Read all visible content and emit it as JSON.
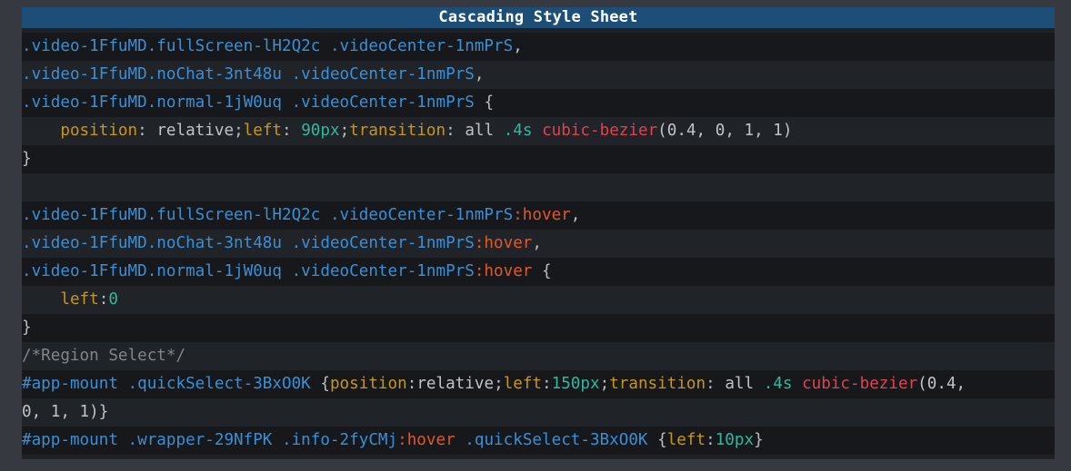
{
  "title": "Cascading Style Sheet",
  "lines": [
    [
      [
        ".video-1FfuMD.fullScreen-lH2Q2c .videoCenter-1nmPrS",
        "sel"
      ],
      [
        ",",
        "pun"
      ]
    ],
    [
      [
        ".video-1FfuMD.noChat-3nt48u .videoCenter-1nmPrS",
        "sel"
      ],
      [
        ",",
        "pun"
      ]
    ],
    [
      [
        ".video-1FfuMD.normal-1jW0uq .videoCenter-1nmPrS ",
        "sel"
      ],
      [
        "{",
        "pun"
      ]
    ],
    [
      [
        "    ",
        "val"
      ],
      [
        "position",
        "prop"
      ],
      [
        ": ",
        "pun"
      ],
      [
        "relative",
        "val"
      ],
      [
        ";",
        "pun"
      ],
      [
        "left",
        "prop"
      ],
      [
        ": ",
        "pun"
      ],
      [
        "90px",
        "num"
      ],
      [
        ";",
        "pun"
      ],
      [
        "transition",
        "prop"
      ],
      [
        ": ",
        "pun"
      ],
      [
        "all ",
        "val"
      ],
      [
        ".4s ",
        "num"
      ],
      [
        "cubic-bezier",
        "fn"
      ],
      [
        "(0.4, 0, 1, 1)",
        "val"
      ]
    ],
    [
      [
        "}",
        "pun"
      ]
    ],
    [],
    [
      [
        ".video-1FfuMD.fullScreen-lH2Q2c .videoCenter-1nmPrS",
        "sel"
      ],
      [
        ":hover",
        "pse"
      ],
      [
        ",",
        "pun"
      ]
    ],
    [
      [
        ".video-1FfuMD.noChat-3nt48u .videoCenter-1nmPrS",
        "sel"
      ],
      [
        ":hover",
        "pse"
      ],
      [
        ",",
        "pun"
      ]
    ],
    [
      [
        ".video-1FfuMD.normal-1jW0uq .videoCenter-1nmPrS",
        "sel"
      ],
      [
        ":hover ",
        "pse"
      ],
      [
        "{",
        "pun"
      ]
    ],
    [
      [
        "    ",
        "val"
      ],
      [
        "left",
        "prop"
      ],
      [
        ":",
        "pun"
      ],
      [
        "0",
        "num"
      ]
    ],
    [
      [
        "}",
        "pun"
      ]
    ],
    [
      [
        "/*Region Select*/",
        "com"
      ]
    ],
    [
      [
        "#app-mount .quickSelect-3BxO0K ",
        "sel"
      ],
      [
        "{",
        "pun"
      ],
      [
        "position",
        "prop"
      ],
      [
        ":",
        "pun"
      ],
      [
        "relative",
        "val"
      ],
      [
        ";",
        "pun"
      ],
      [
        "left",
        "prop"
      ],
      [
        ":",
        "pun"
      ],
      [
        "150px",
        "num"
      ],
      [
        ";",
        "pun"
      ],
      [
        "transition",
        "prop"
      ],
      [
        ": ",
        "pun"
      ],
      [
        "all ",
        "val"
      ],
      [
        ".4s ",
        "num"
      ],
      [
        "cubic-bezier",
        "fn"
      ],
      [
        "(0.4,",
        "val"
      ]
    ],
    [
      [
        "0, 1, 1)}",
        "val"
      ]
    ],
    [
      [
        "#app-mount .wrapper-29NfPK .info-2fyCMj",
        "sel"
      ],
      [
        ":hover ",
        "pse"
      ],
      [
        ".quickSelect-3BxO0K ",
        "sel"
      ],
      [
        "{",
        "pun"
      ],
      [
        "left",
        "prop"
      ],
      [
        ":",
        "pun"
      ],
      [
        "10px",
        "num"
      ],
      [
        "}",
        "pun"
      ]
    ]
  ]
}
